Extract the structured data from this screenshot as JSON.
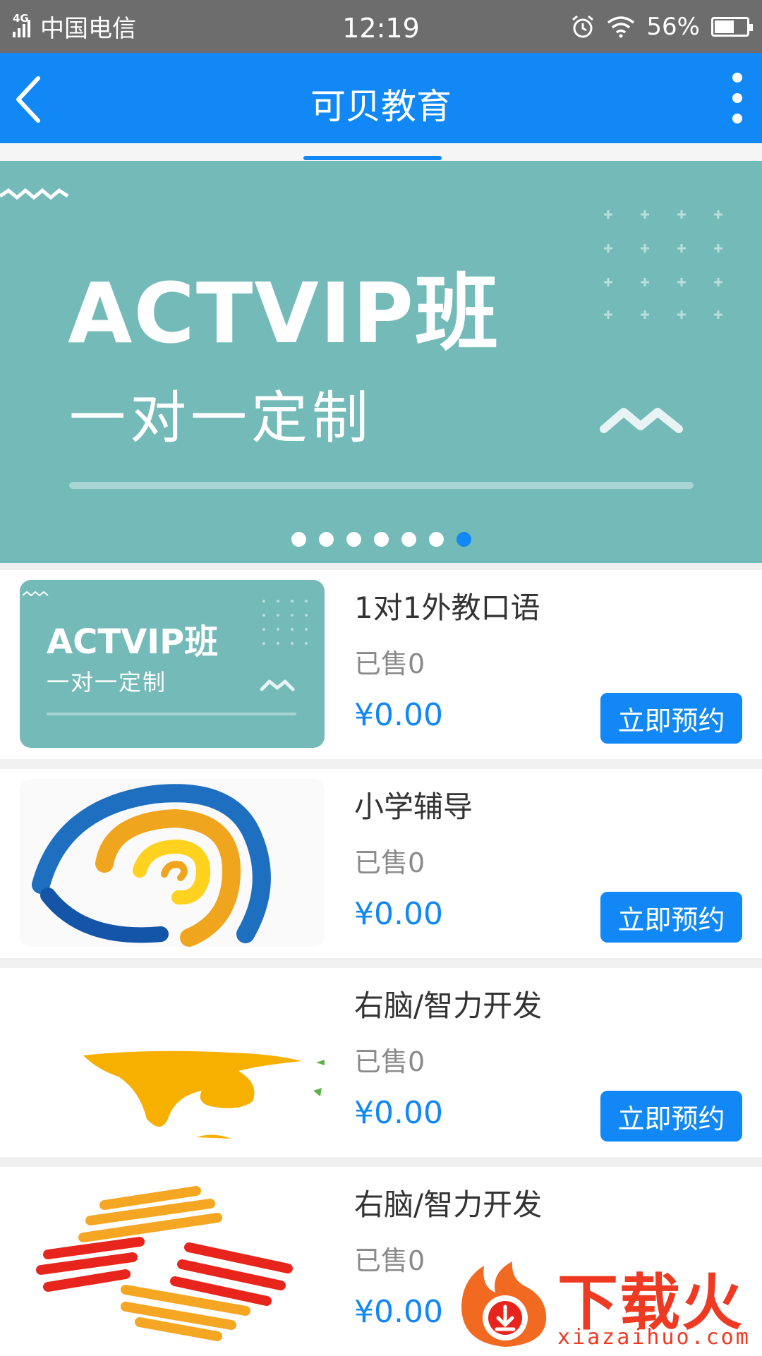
{
  "status_bar": {
    "network": "4G",
    "carrier": "中国电信",
    "time": "12:19",
    "battery": "56%"
  },
  "app_bar": {
    "title": "可贝教育"
  },
  "banner": {
    "title": "ACTVIP班",
    "subtitle": "一对一定制",
    "slide_count": 7,
    "active_slide": 7
  },
  "courses": [
    {
      "name": "1对1外教口语",
      "sold": "已售0",
      "price": "¥0.00",
      "button": "立即预约",
      "thumb_title": "ACTVIP班",
      "thumb_subtitle": "一对一定制"
    },
    {
      "name": "小学辅导",
      "sold": "已售0",
      "price": "¥0.00",
      "button": "立即预约"
    },
    {
      "name": "右脑/智力开发",
      "sold": "已售0",
      "price": "¥0.00",
      "button": "立即预约"
    },
    {
      "name": "右脑/智力开发",
      "sold": "已售0",
      "price": "¥0.00"
    }
  ],
  "watermark": {
    "brand": "下载火",
    "url": "xiazaihuo.com"
  },
  "colors": {
    "accent": "#1188f6",
    "banner": "#74bab8",
    "status_bar": "#6d6d6d"
  }
}
